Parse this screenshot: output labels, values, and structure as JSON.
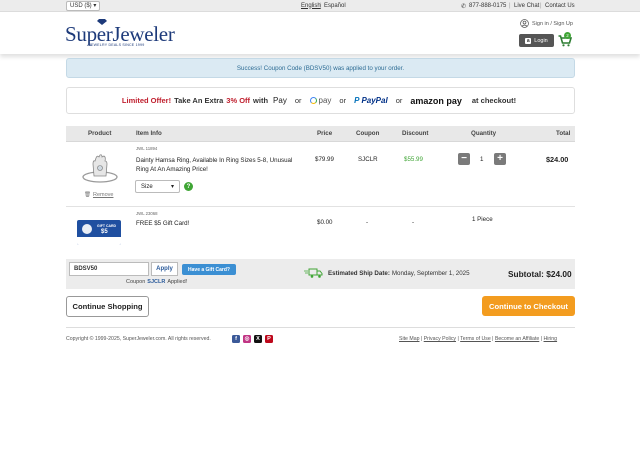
{
  "topbar": {
    "currency": "USD ($)",
    "lang_en": "English",
    "lang_es": "Español",
    "phone": "877-888-0175",
    "live_chat": "Live Chat",
    "contact": "Contact Us"
  },
  "header": {
    "logo": "SuperJeweler",
    "tagline": "JEWELRY DEALS SINCE 1999",
    "signin": "Sign in / Sign Up",
    "login_button": "Login",
    "cart_count": "2"
  },
  "success_message": "Success! Coupon Code (BDSV50) was applied to your order.",
  "offer": {
    "limited": "Limited Offer!",
    "take": "Take An Extra",
    "pct": "3% Off",
    "with": "with",
    "or": "or",
    "apple_pay": "Pay",
    "google_pay": "pay",
    "paypal": "PayPal",
    "amazon_pay": "amazon pay",
    "checkout": "at checkout!"
  },
  "table": {
    "headers": [
      "Product",
      "Item Info",
      "Price",
      "Coupon",
      "Discount",
      "Quantity",
      "Total"
    ],
    "rows": [
      {
        "sku": "JWL 11894",
        "name_line1": "Dainty Hamsa Ring, Available In Ring Sizes 5-8, Unusual",
        "name_line2": "Ring At An Amazing Price!",
        "size_label": "Size",
        "price": "$79.99",
        "coupon": "SJCLR",
        "discount": "$55.99",
        "qty": "1",
        "total": "$24.00",
        "remove": "Remove"
      },
      {
        "sku": "JWL 23068",
        "name": "FREE $5 Gift Card!",
        "card_text": "GIFT CARD",
        "card_amount": "$5",
        "price": "$0.00",
        "coupon": "-",
        "discount": "-",
        "qty": "1 Piece"
      }
    ]
  },
  "coupon": {
    "value": "BDSV50",
    "apply": "Apply",
    "gift_card": "Have a Gift Card?",
    "applied_prefix": "Coupon",
    "applied_code": "SJCLR",
    "applied_suffix": "Applied!"
  },
  "ship": {
    "label": "Estimated Ship Date:",
    "date": "Monday, September 1, 2025"
  },
  "subtotal": "Subtotal: $24.00",
  "buttons": {
    "continue": "Continue Shopping",
    "checkout": "Continue to Checkout"
  },
  "footer": {
    "copyright": "Copyright © 1999-2025, SuperJeweler.com. All rights reserved.",
    "links": [
      "Site Map",
      "Privacy Policy",
      "Terms of Use",
      "Become an Affiliate",
      "Hiring"
    ]
  },
  "colors": {
    "accent_orange": "#f39c1f",
    "discount_green": "#3fa535",
    "offer_red": "#c0202f",
    "brand_blue": "#1d3a7a"
  }
}
